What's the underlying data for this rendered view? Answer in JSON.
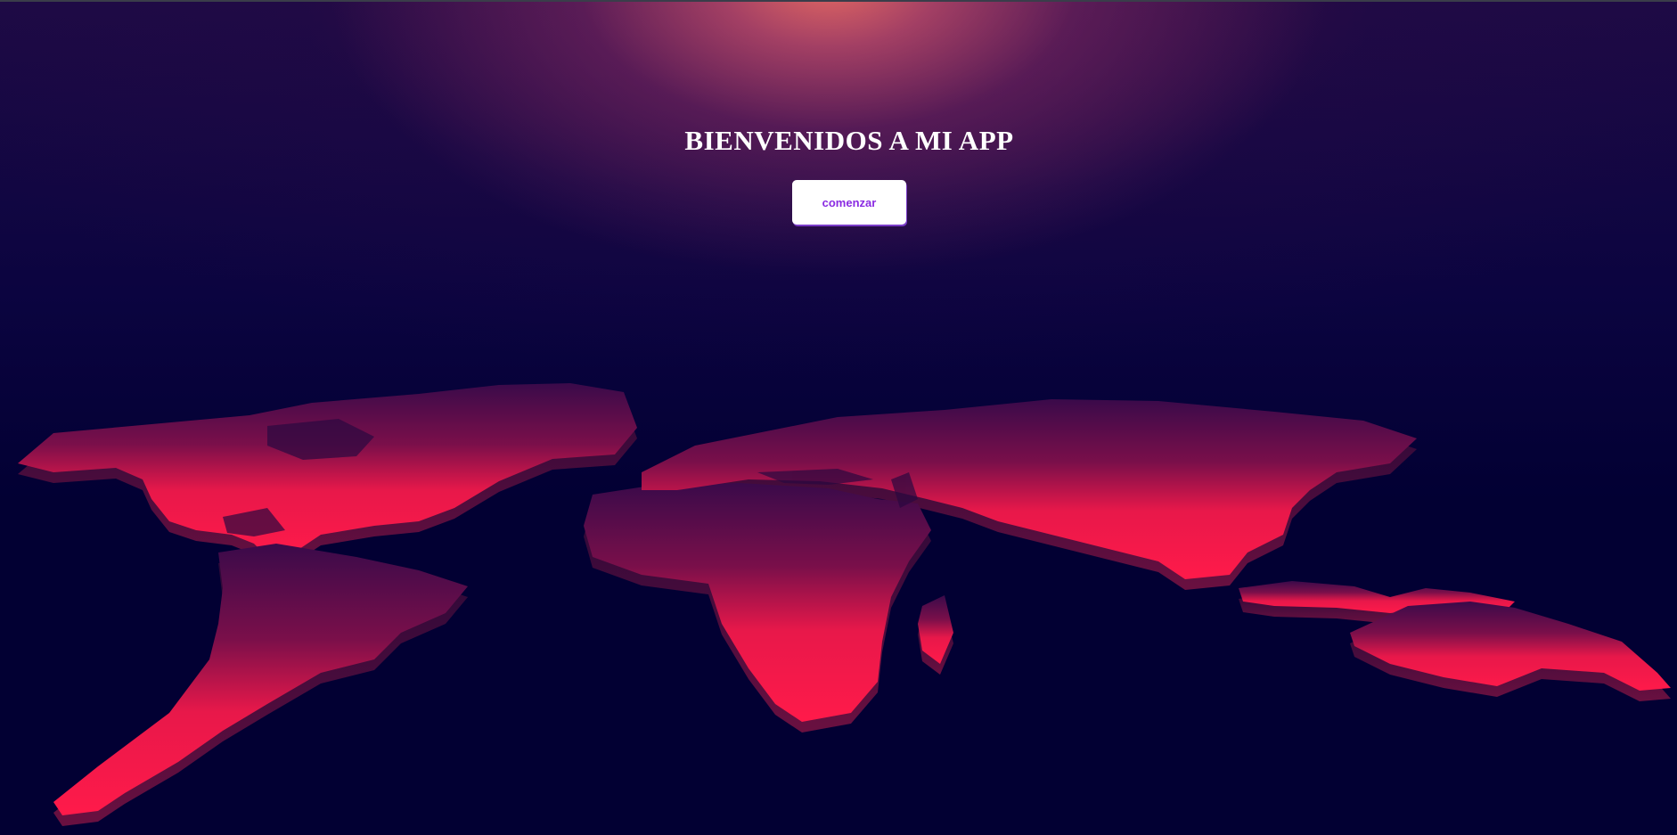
{
  "hero": {
    "title": "BIENVENIDOS A MI APP",
    "button_label": "comenzar"
  },
  "colors": {
    "background": "#020033",
    "glow": "#ec6e64",
    "continent": "#ff1a4a",
    "continent_shadow": "#6a1040",
    "button_text": "#8a2be2",
    "title_text": "#ffffff"
  },
  "map": {
    "icon": "world-map-3d"
  }
}
